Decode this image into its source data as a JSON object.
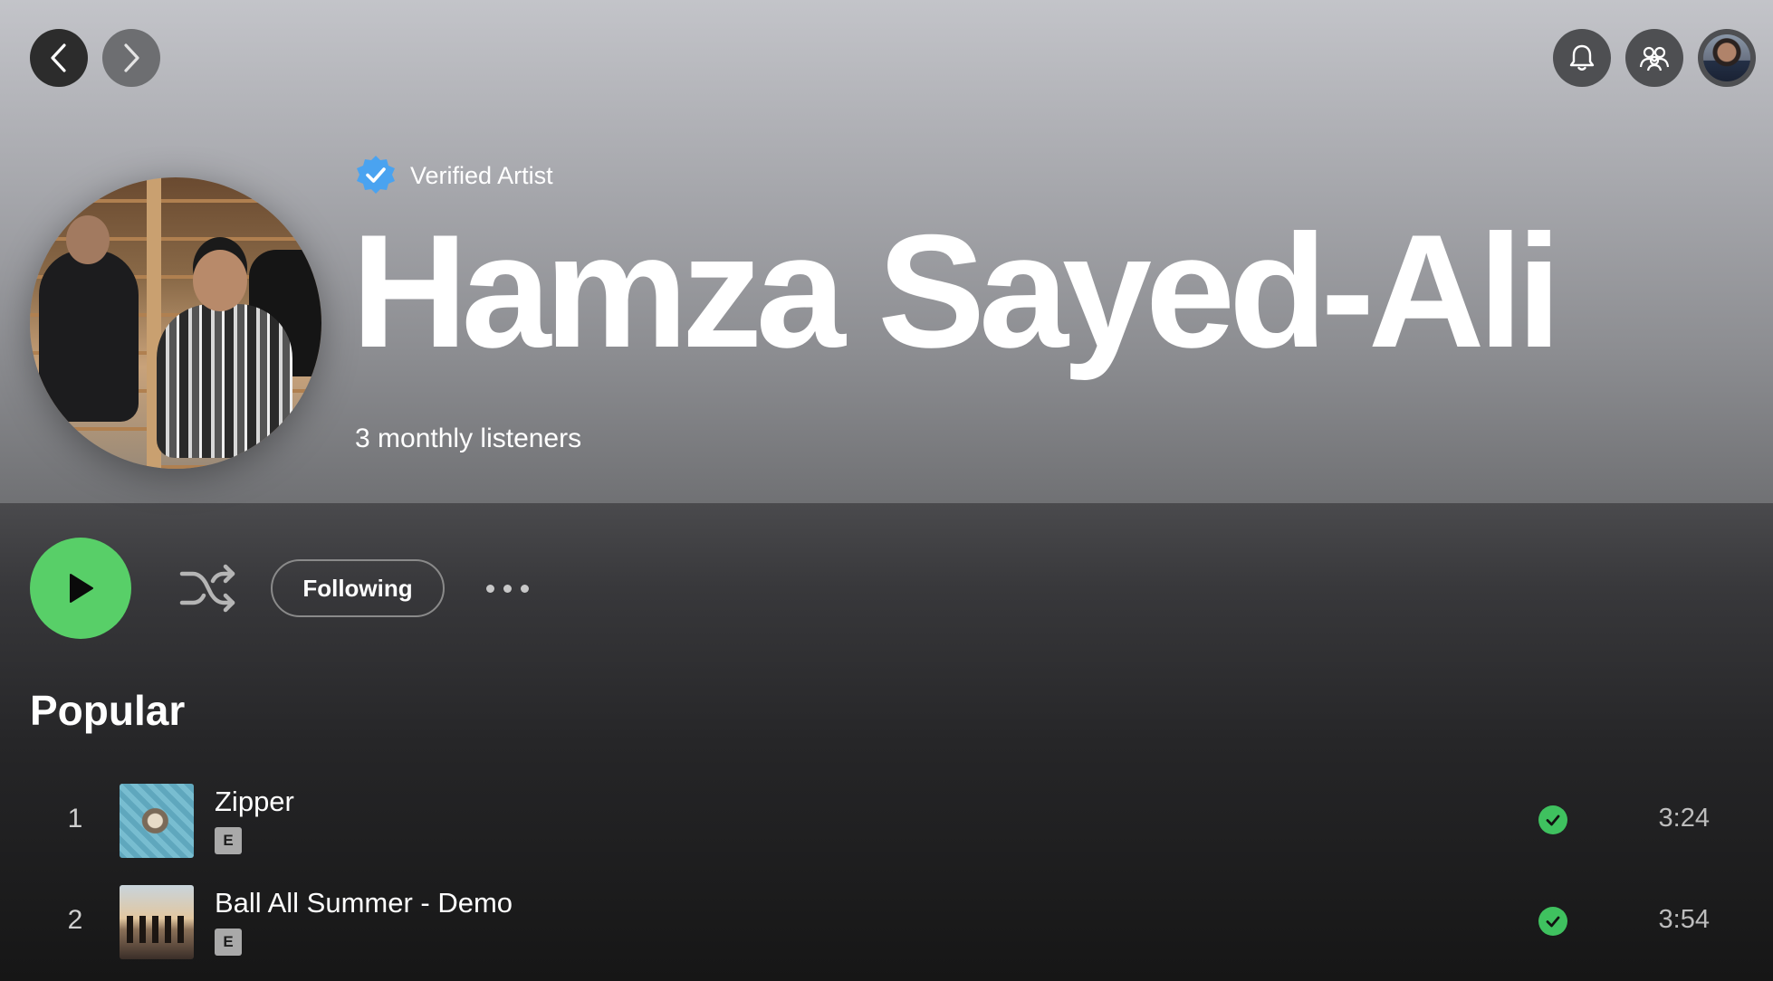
{
  "header": {
    "back_icon": "chevron-left-icon",
    "forward_icon": "chevron-right-icon",
    "notifications_icon": "bell-icon",
    "friends_icon": "friends-activity-icon"
  },
  "artist": {
    "verified_label": "Verified Artist",
    "name": "Hamza Sayed-Ali",
    "monthly_listeners": "3 monthly listeners",
    "verified_color": "#4aa3f0"
  },
  "actions": {
    "play_icon": "play-icon",
    "shuffle_icon": "shuffle-icon",
    "following_label": "Following",
    "more_icon": "more-options-icon",
    "accent_color": "#58cf68"
  },
  "popular": {
    "title": "Popular",
    "tracks": [
      {
        "number": "1",
        "title": "Zipper",
        "explicit": "E",
        "duration": "3:24",
        "saved": true
      },
      {
        "number": "2",
        "title": "Ball All Summer - Demo",
        "explicit": "E",
        "duration": "3:54",
        "saved": true
      }
    ]
  }
}
